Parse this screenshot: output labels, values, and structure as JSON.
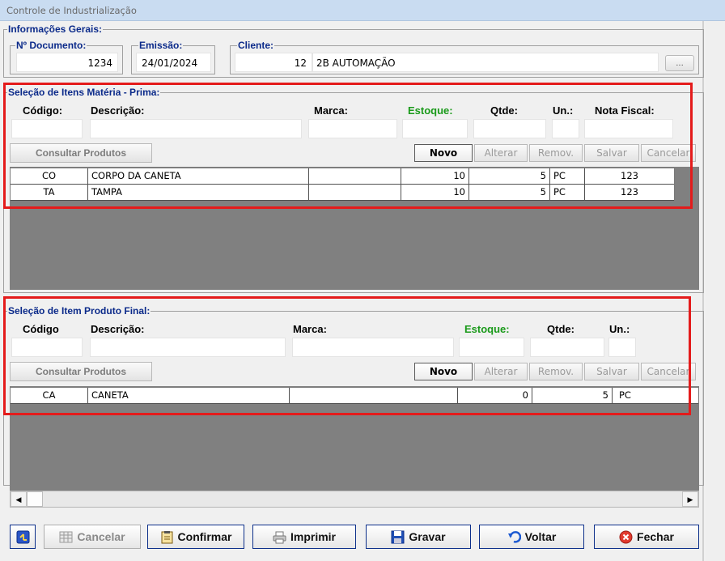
{
  "window": {
    "title": "Controle de Industrialização"
  },
  "info": {
    "legend": "Informações Gerais:",
    "documento_label": "Nº Documento:",
    "documento_value": "1234",
    "emissao_label": "Emissão:",
    "emissao_value": "24/01/2024",
    "cliente_label": "Cliente:",
    "cliente_code": "12",
    "cliente_name": "2B AUTOMAÇÃO",
    "lookup_label": "..."
  },
  "materia": {
    "legend": "Seleção de Itens Matéria - Prima:",
    "headers": {
      "codigo": "Código:",
      "descricao": "Descrição:",
      "marca": "Marca:",
      "estoque": "Estoque:",
      "qtde": "Qtde:",
      "un": "Un.:",
      "nota": "Nota Fiscal:"
    },
    "consult_label": "Consultar Produtos",
    "buttons": {
      "novo": "Novo",
      "alterar": "Alterar",
      "remover": "Remov.",
      "salvar": "Salvar",
      "cancelar": "Cancelar"
    },
    "rows": [
      {
        "codigo": "CO",
        "descricao": "CORPO DA CANETA",
        "marca": "",
        "estoque": "10",
        "qtde": "5",
        "un": "PC",
        "nota": "123"
      },
      {
        "codigo": "TA",
        "descricao": "TAMPA",
        "marca": "",
        "estoque": "10",
        "qtde": "5",
        "un": "PC",
        "nota": "123"
      }
    ]
  },
  "produto": {
    "legend": "Seleção de Item Produto Final:",
    "headers": {
      "codigo": "Código",
      "descricao": "Descrição:",
      "marca": "Marca:",
      "estoque": "Estoque:",
      "qtde": "Qtde:",
      "un": "Un.:"
    },
    "consult_label": "Consultar Produtos",
    "buttons": {
      "novo": "Novo",
      "alterar": "Alterar",
      "remover": "Remov.",
      "salvar": "Salvar",
      "cancelar": "Cancelar"
    },
    "rows": [
      {
        "codigo": "CA",
        "descricao": "CANETA",
        "marca": "",
        "estoque": "0",
        "qtde": "5",
        "un": "PC"
      }
    ]
  },
  "footer": {
    "cancelar": "Cancelar",
    "confirmar": "Confirmar",
    "imprimir": "Imprimir",
    "gravar": "Gravar",
    "voltar": "Voltar",
    "fechar": "Fechar"
  },
  "colors": {
    "accent": "#0b2a8a",
    "highlight_box": "#e41b1b",
    "stock_label": "#1a9a1a",
    "grid_bg": "#808080"
  }
}
